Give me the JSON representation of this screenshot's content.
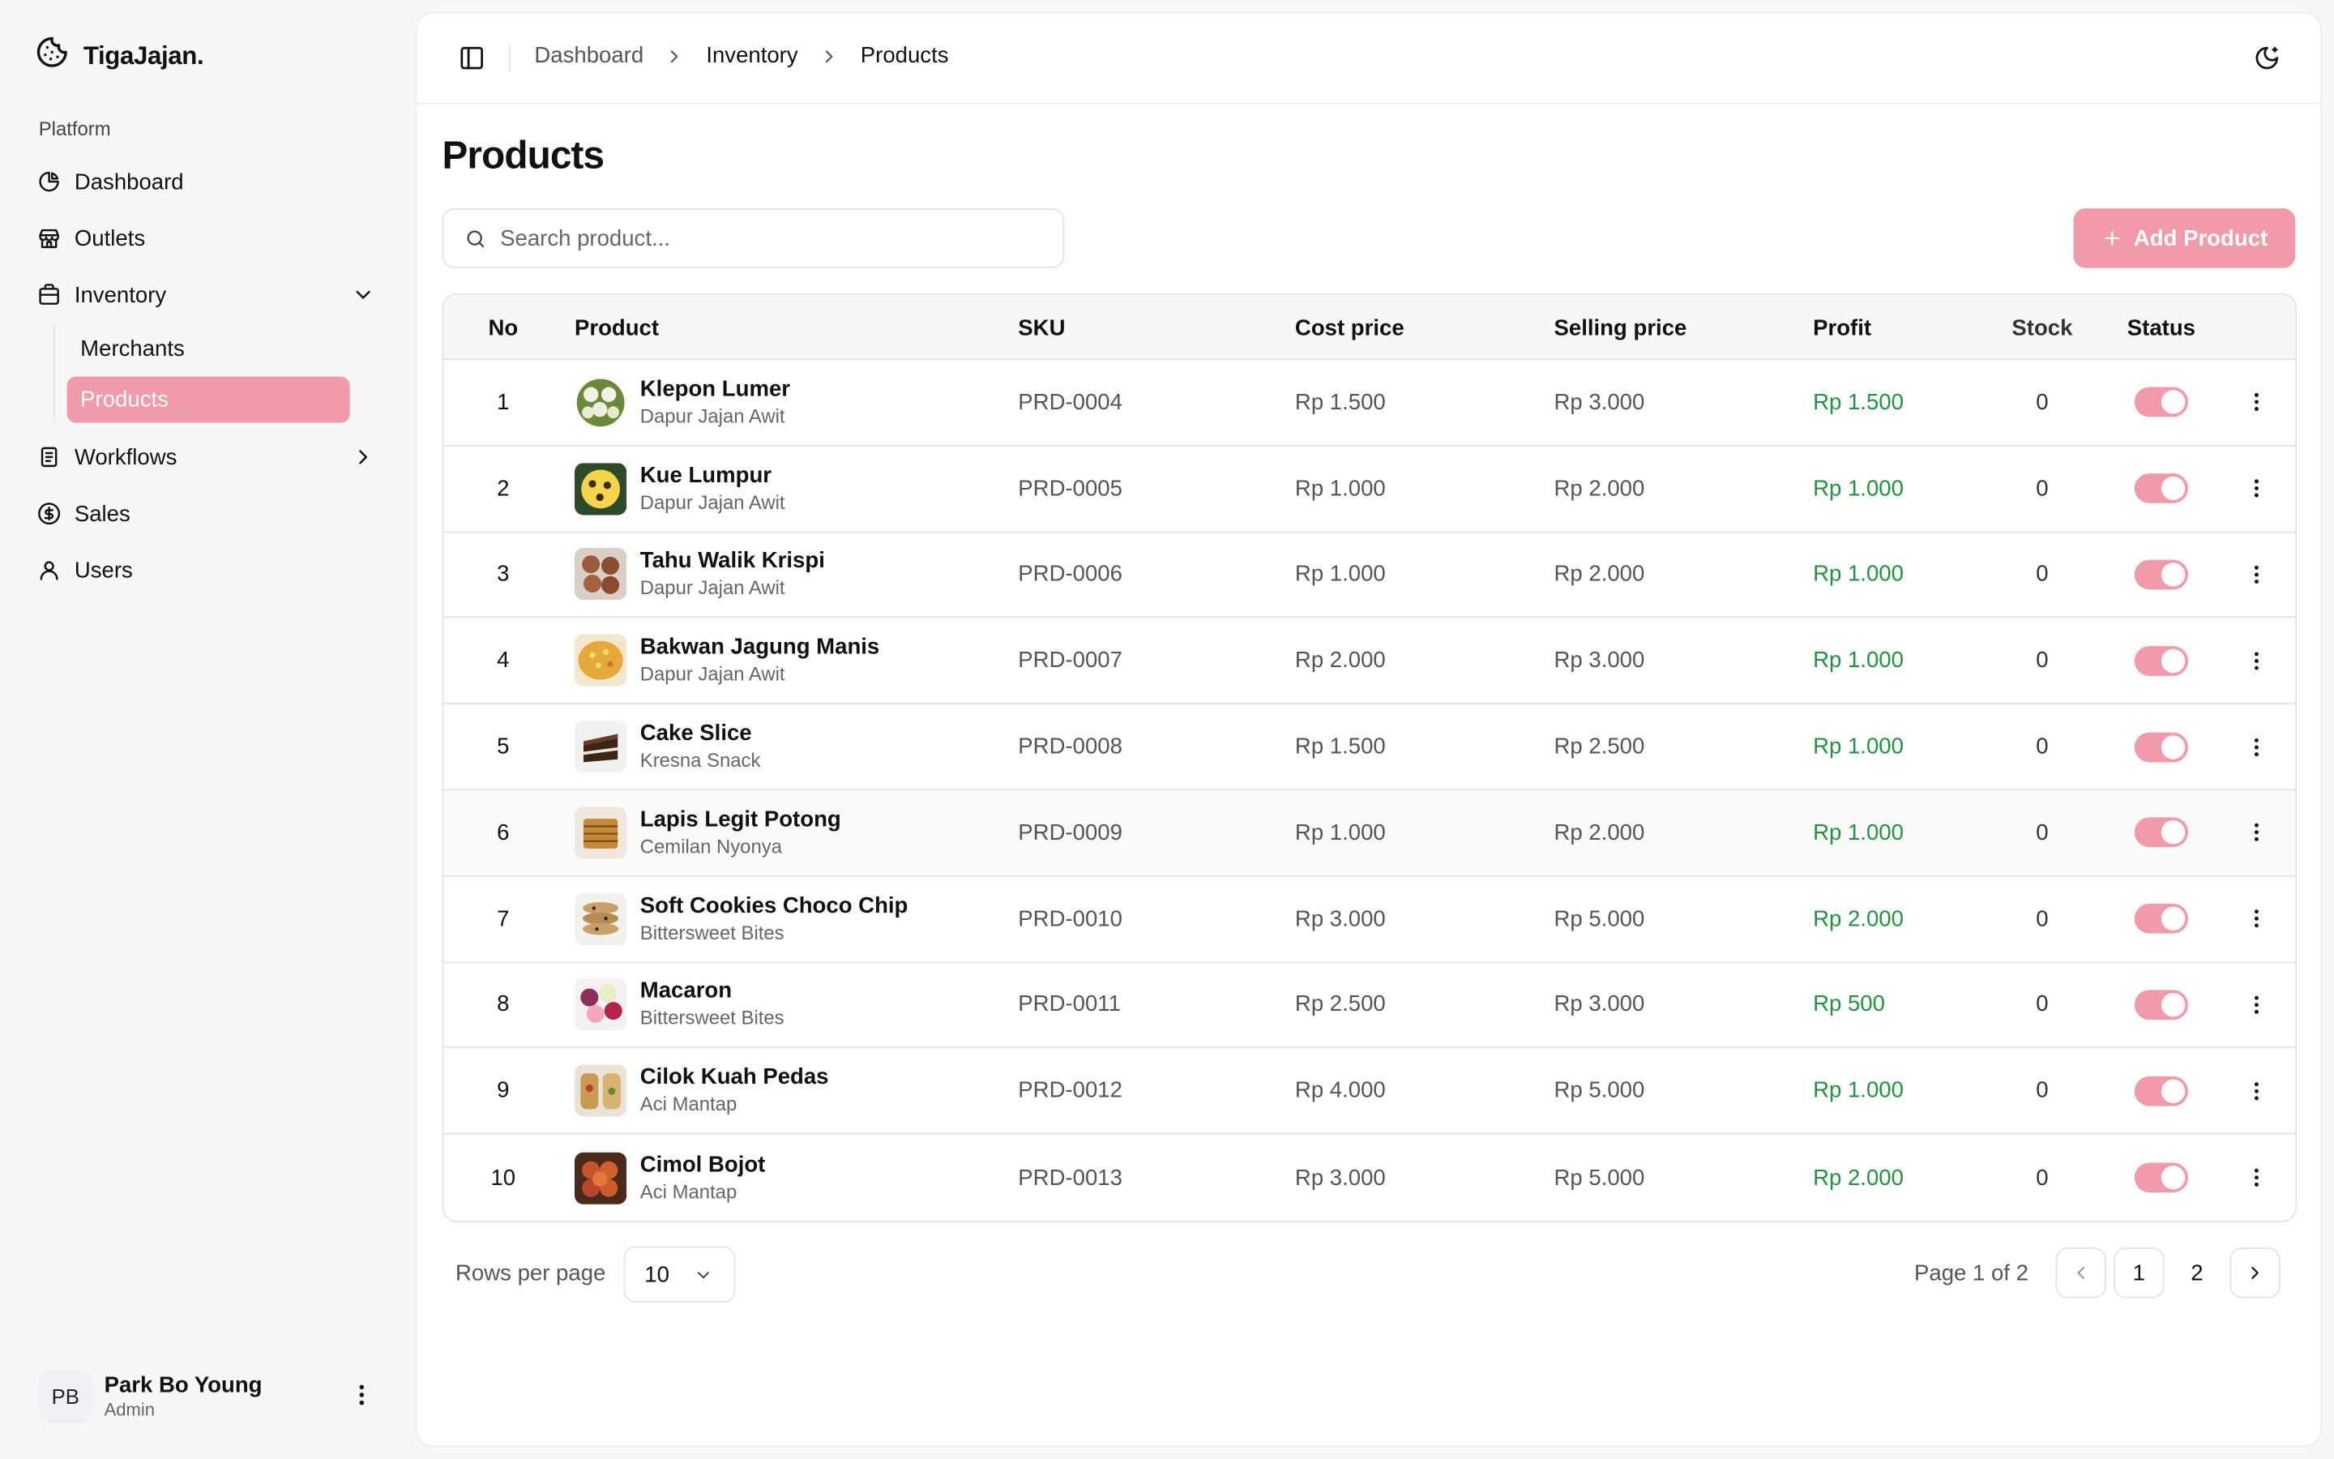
{
  "app": {
    "brand": "TigaJajan."
  },
  "sidebar": {
    "section_label": "Platform",
    "items": [
      {
        "label": "Dashboard",
        "icon": "pie-chart-icon"
      },
      {
        "label": "Outlets",
        "icon": "store-icon"
      },
      {
        "label": "Inventory",
        "icon": "package-icon",
        "expanded": true
      },
      {
        "label": "Workflows",
        "icon": "clipboard-icon"
      },
      {
        "label": "Sales",
        "icon": "dollar-circle-icon"
      },
      {
        "label": "Users",
        "icon": "user-icon"
      }
    ],
    "inventory_sub": [
      {
        "label": "Merchants",
        "active": false
      },
      {
        "label": "Products",
        "active": true
      }
    ]
  },
  "user": {
    "initials": "PB",
    "name": "Park Bo Young",
    "role": "Admin"
  },
  "breadcrumb": [
    "Dashboard",
    "Inventory",
    "Products"
  ],
  "page": {
    "title": "Products"
  },
  "search": {
    "placeholder": "Search product...",
    "value": ""
  },
  "toolbar": {
    "add_label": "Add Product"
  },
  "table": {
    "columns": [
      "No",
      "Product",
      "SKU",
      "Cost price",
      "Selling price",
      "Profit",
      "Stock",
      "Status"
    ],
    "rows": [
      {
        "no": "1",
        "name": "Klepon Lumer",
        "merchant": "Dapur Jajan Awit",
        "sku": "PRD-0004",
        "cost": "Rp 1.500",
        "sell": "Rp 3.000",
        "profit": "Rp 1.500",
        "stock": "0",
        "active": true
      },
      {
        "no": "2",
        "name": "Kue Lumpur",
        "merchant": "Dapur Jajan Awit",
        "sku": "PRD-0005",
        "cost": "Rp 1.000",
        "sell": "Rp 2.000",
        "profit": "Rp 1.000",
        "stock": "0",
        "active": true
      },
      {
        "no": "3",
        "name": "Tahu Walik Krispi",
        "merchant": "Dapur Jajan Awit",
        "sku": "PRD-0006",
        "cost": "Rp 1.000",
        "sell": "Rp 2.000",
        "profit": "Rp 1.000",
        "stock": "0",
        "active": true
      },
      {
        "no": "4",
        "name": "Bakwan Jagung Manis",
        "merchant": "Dapur Jajan Awit",
        "sku": "PRD-0007",
        "cost": "Rp 2.000",
        "sell": "Rp 3.000",
        "profit": "Rp 1.000",
        "stock": "0",
        "active": true
      },
      {
        "no": "5",
        "name": "Cake Slice",
        "merchant": "Kresna Snack",
        "sku": "PRD-0008",
        "cost": "Rp 1.500",
        "sell": "Rp 2.500",
        "profit": "Rp 1.000",
        "stock": "0",
        "active": true
      },
      {
        "no": "6",
        "name": "Lapis Legit Potong",
        "merchant": "Cemilan Nyonya",
        "sku": "PRD-0009",
        "cost": "Rp 1.000",
        "sell": "Rp 2.000",
        "profit": "Rp 1.000",
        "stock": "0",
        "active": true
      },
      {
        "no": "7",
        "name": "Soft Cookies Choco Chip",
        "merchant": "Bittersweet Bites",
        "sku": "PRD-0010",
        "cost": "Rp 3.000",
        "sell": "Rp 5.000",
        "profit": "Rp 2.000",
        "stock": "0",
        "active": true
      },
      {
        "no": "8",
        "name": "Macaron",
        "merchant": "Bittersweet Bites",
        "sku": "PRD-0011",
        "cost": "Rp 2.500",
        "sell": "Rp 3.000",
        "profit": "Rp 500",
        "stock": "0",
        "active": true
      },
      {
        "no": "9",
        "name": "Cilok Kuah Pedas",
        "merchant": "Aci Mantap",
        "sku": "PRD-0012",
        "cost": "Rp 4.000",
        "sell": "Rp 5.000",
        "profit": "Rp 1.000",
        "stock": "0",
        "active": true
      },
      {
        "no": "10",
        "name": "Cimol Bojot",
        "merchant": "Aci Mantap",
        "sku": "PRD-0013",
        "cost": "Rp 3.000",
        "sell": "Rp 5.000",
        "profit": "Rp 2.000",
        "stock": "0",
        "active": true
      }
    ]
  },
  "pagination": {
    "rows_per_page_label": "Rows per page",
    "rows_per_page": "10",
    "page_info": "Page 1 of 2",
    "pages": [
      "1",
      "2"
    ],
    "current": "1"
  },
  "colors": {
    "accent": "#f19aaa",
    "profit": "#22923f",
    "border": "#e4e4e7"
  }
}
